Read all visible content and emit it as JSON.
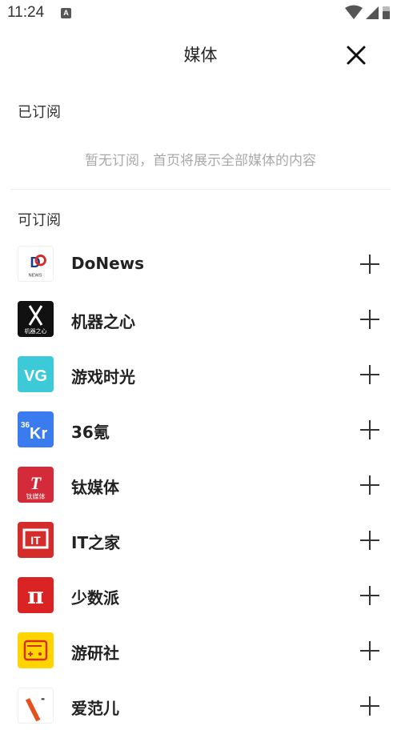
{
  "status_bar": {
    "time": "11:24",
    "app_badge": "A"
  },
  "header": {
    "title": "媒体"
  },
  "subscribed": {
    "heading": "已订阅",
    "empty_text": "暂无订阅，首页将展示全部媒体的内容"
  },
  "available": {
    "heading": "可订阅",
    "items": [
      {
        "name": "DoNews",
        "logo_text": "DO",
        "logo_sub": "NEWS",
        "logo_bg": "#ffffff",
        "logo_fg": "#1a3a8a"
      },
      {
        "name": "机器之心",
        "logo_text": "X",
        "logo_sub": "机器之心",
        "logo_bg": "#111111",
        "logo_fg": "#ffffff"
      },
      {
        "name": "游戏时光",
        "logo_text": "VG",
        "logo_sub": "",
        "logo_bg": "#3cc9d8",
        "logo_fg": "#ffffff"
      },
      {
        "name": "36氪",
        "logo_text": "36Kr",
        "logo_sub": "",
        "logo_bg": "#3a7cf0",
        "logo_fg": "#ffffff"
      },
      {
        "name": "钛媒体",
        "logo_text": "T",
        "logo_sub": "钛媒体",
        "logo_bg": "#d42b3a",
        "logo_fg": "#ffffff"
      },
      {
        "name": "IT之家",
        "logo_text": "IT",
        "logo_sub": "",
        "logo_bg": "#d42b2b",
        "logo_fg": "#ffffff"
      },
      {
        "name": "少数派",
        "logo_text": "π",
        "logo_sub": "",
        "logo_bg": "#da2323",
        "logo_fg": "#ffffff"
      },
      {
        "name": "游研社",
        "logo_text": "",
        "logo_sub": "",
        "logo_bg": "#ffd400",
        "logo_fg": "#d4301c"
      },
      {
        "name": "爱范儿",
        "logo_text": "",
        "logo_sub": "",
        "logo_bg": "#ffffff",
        "logo_fg": "#e5501e"
      }
    ]
  }
}
